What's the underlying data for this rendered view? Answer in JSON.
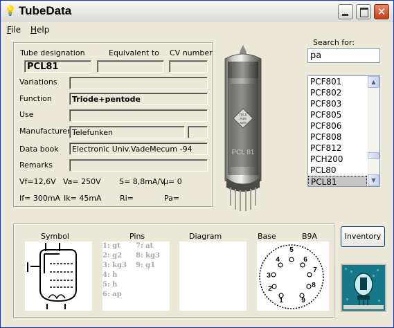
{
  "window": {
    "title": "TubeData",
    "icon": "lightbulb-icon"
  },
  "menu": {
    "file": "File",
    "help": "Help"
  },
  "labels": {
    "tube_designation": "Tube designation",
    "equivalent_to": "Equivalent to",
    "cv_number": "CV number",
    "variations": "Variations",
    "function": "Function",
    "use": "Use",
    "manufacturer": "Manufacturer",
    "data_book": "Data book",
    "remarks": "Remarks"
  },
  "values": {
    "tube_designation": "PCL81",
    "equivalent_to": "",
    "cv_number": "",
    "variations": "",
    "function": "Triode+pentode",
    "use": "",
    "manufacturer": "Telefunken",
    "manufacturer_extra": "",
    "data_book": "Electronic Univ.VadeMecum -94",
    "remarks": ""
  },
  "specs": {
    "vf": "Vf=12,6V",
    "va": "Va= 250V",
    "s": "S= 8,8mA/V",
    "mu": "µ=   0",
    "if": "If= 300mA",
    "ik": "Ik=   45mA",
    "ri": "Ri=",
    "pa": "Pa="
  },
  "search": {
    "label": "Search for:",
    "value": "pa"
  },
  "results": {
    "items": [
      "PCF801",
      "PCF802",
      "PCF803",
      "PCF805",
      "PCF806",
      "PCF808",
      "PCF812",
      "PCH200",
      "PCL80",
      "PCL81"
    ],
    "selected": "PCL81"
  },
  "bottom": {
    "symbol": "Symbol",
    "pins": "Pins",
    "diagram": "Diagram",
    "base": "Base",
    "base_type": "B9A"
  },
  "pin_list": {
    "p1": "1: gt",
    "p2": "2: g2",
    "p3": "3: kg3",
    "p4": "4: h",
    "p5": "5: h",
    "p6": "6: ap",
    "p7": "7: at",
    "p8": "8: kg3",
    "p9": "9: g1"
  },
  "base_pin_numbers": [
    "1",
    "2",
    "3",
    "4",
    "5",
    "6",
    "7",
    "8",
    "9"
  ],
  "buttons": {
    "inventory": "Inventory"
  },
  "tube_photo": {
    "brand_marks": [
      "TELE",
      "FUN",
      "KEN"
    ],
    "print": "PCL 81"
  }
}
